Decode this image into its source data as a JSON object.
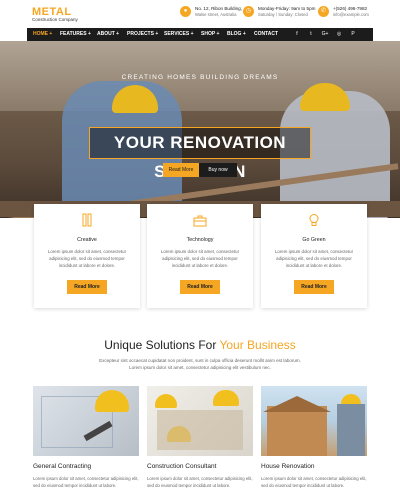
{
  "header": {
    "logo_title": "METAL",
    "logo_subtitle": "Construction Company",
    "address_line1": "No. 12, Ribon Building,",
    "address_line2": "Walse street, Australia",
    "hours_line1": "Monday-Friday: 9am to 5pm",
    "hours_line2": "Saturday / Sunday: Closed",
    "phone": "+(526) 496-7982",
    "email": "info@example.com",
    "accent_color": "#f5a623"
  },
  "nav": {
    "items": [
      "HOME +",
      "FEATURES +",
      "ABOUT +",
      "PROJECTS +",
      "SERVICES +",
      "SHOP +",
      "BLOG +",
      "CONTACT"
    ],
    "social_icons": [
      "facebook-icon",
      "twitter-icon",
      "google-plus-icon",
      "instagram-icon",
      "pinterest-icon"
    ],
    "social_glyphs": [
      "f",
      "t",
      "G+",
      "◎",
      "P"
    ]
  },
  "hero": {
    "tagline": "CREATING HOMES BUILDING DREAMS",
    "title": "YOUR RENOVATION SOLUTION",
    "read_more": "Read More",
    "buy_now": "Buy now"
  },
  "features": [
    {
      "icon": "pencil-ruler-icon",
      "title": "Creative",
      "text": "Lorem ipsum dolor sit amet, consectetur adipisicing elit, sed do eiusmod tempor incididunt ut labore et dolore.",
      "button": "Read More"
    },
    {
      "icon": "toolbox-icon",
      "title": "Technology",
      "text": "Lorem ipsum dolor sit amet, consectetur adipisicing elit, sed do eiusmod tempor incididunt ut labore et dolore.",
      "button": "Read More"
    },
    {
      "icon": "lightbulb-icon",
      "title": "Go Green",
      "text": "Lorem ipsum dolor sit amet, consectetur adipisicing elit, sed do eiusmod tempor incididunt ut labore et dolore.",
      "button": "Read More"
    }
  ],
  "solutions": {
    "title_plain": "Unique Solutions For ",
    "title_highlight": "Your Business",
    "description": "Excepteur sint occaecat cupidatat non proident, sunt in culpa officia deserunt mollit anim est laborum. Lorem ipsum dolor sit amet, consectetur adipisicing elit vestibulum nec.",
    "services": [
      {
        "title": "General Contracting",
        "text": "Lorem ipsum dolor sit amet, consectetur adipisicing elit, sed do eiusmod tempor incididunt ut labore."
      },
      {
        "title": "Construction Consultant",
        "text": "Lorem ipsum dolor sit amet, consectetur adipisicing elit, sed do eiusmod tempor incididunt ut labore."
      },
      {
        "title": "House Renovation",
        "text": "Lorem ipsum dolor sit amet, consectetur adipisicing elit, sed do eiusmod tempor incididunt ut labore."
      }
    ]
  }
}
